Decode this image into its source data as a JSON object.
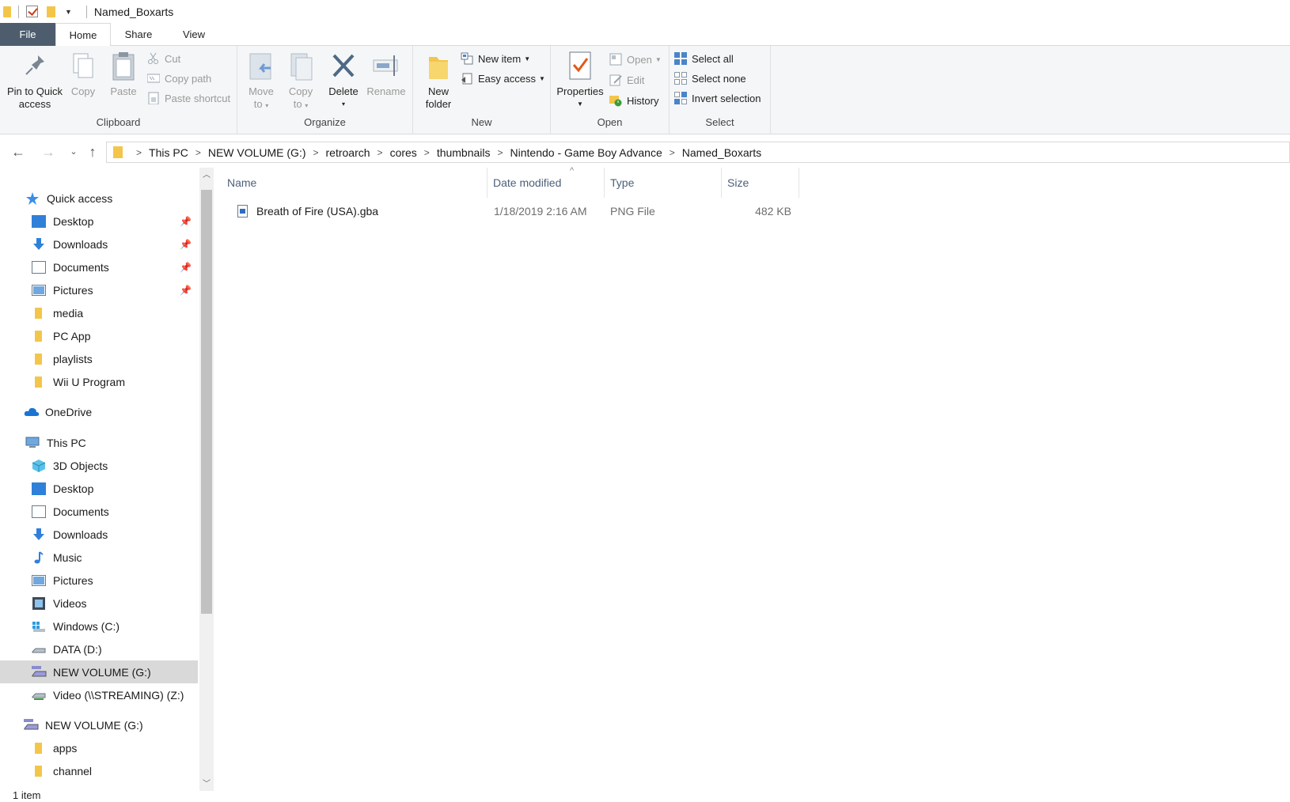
{
  "window": {
    "title": "Named_Boxarts"
  },
  "ribbon_tabs": [
    "File",
    "Home",
    "Share",
    "View"
  ],
  "ribbon": {
    "clipboard": {
      "label": "Clipboard",
      "pin": "Pin to Quick access",
      "pin_line1": "Pin to Quick",
      "pin_line2": "access",
      "copy": "Copy",
      "paste": "Paste",
      "cut": "Cut",
      "copy_path": "Copy path",
      "paste_shortcut": "Paste shortcut"
    },
    "organize": {
      "label": "Organize",
      "move_to_1": "Move",
      "move_to_2": "to",
      "copy_to_1": "Copy",
      "copy_to_2": "to",
      "delete": "Delete",
      "rename": "Rename"
    },
    "new": {
      "label": "New",
      "new_folder_1": "New",
      "new_folder_2": "folder",
      "new_item": "New item",
      "easy_access": "Easy access"
    },
    "open": {
      "label": "Open",
      "properties": "Properties",
      "open": "Open",
      "edit": "Edit",
      "history": "History"
    },
    "select": {
      "label": "Select",
      "select_all": "Select all",
      "select_none": "Select none",
      "invert": "Invert selection"
    }
  },
  "breadcrumb": [
    "This PC",
    "NEW VOLUME (G:)",
    "retroarch",
    "cores",
    "thumbnails",
    "Nintendo - Game Boy Advance",
    "Named_Boxarts"
  ],
  "nav": {
    "quick_access": "Quick access",
    "qa_items": [
      "Desktop",
      "Downloads",
      "Documents",
      "Pictures",
      "media",
      "PC App",
      "playlists",
      "Wii U Program"
    ],
    "onedrive": "OneDrive",
    "this_pc": "This PC",
    "pc_items": [
      "3D Objects",
      "Desktop",
      "Documents",
      "Downloads",
      "Music",
      "Pictures",
      "Videos",
      "Windows (C:)",
      "DATA (D:)",
      "NEW VOLUME (G:)",
      "Video (\\\\STREAMING) (Z:)"
    ],
    "drive_root": "NEW VOLUME (G:)",
    "drive_items": [
      "apps",
      "channel"
    ]
  },
  "columns": [
    "Name",
    "Date modified",
    "Type",
    "Size"
  ],
  "files": [
    {
      "name": "Breath of Fire (USA).gba",
      "date": "1/18/2019 2:16 AM",
      "type": "PNG File",
      "size": "482 KB"
    }
  ],
  "status": "1 item",
  "colors": {
    "file_tab": "#4d5d6e",
    "header_text": "#4c607a",
    "selected_nav": "#d9d9d9",
    "folder": "#f3c54a"
  }
}
